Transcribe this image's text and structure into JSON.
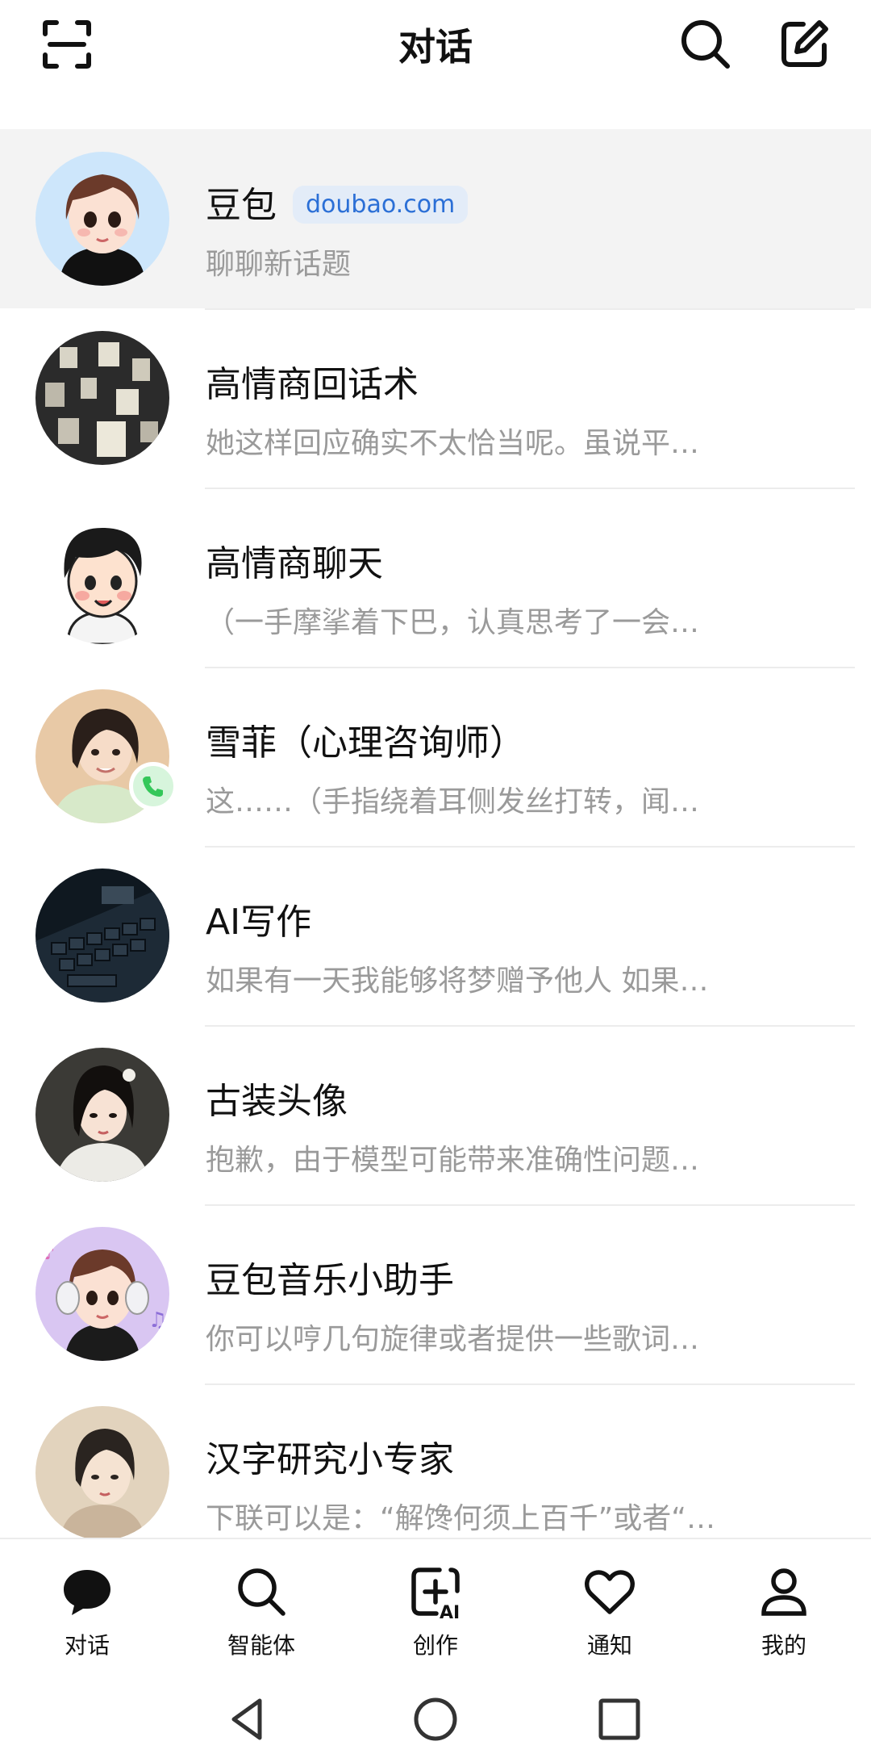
{
  "header": {
    "title": "对话"
  },
  "chats": [
    {
      "name": "豆包",
      "badge": "doubao.com",
      "preview": "聊聊新话题",
      "avatar": "doubao-girl-avatar",
      "active": true
    },
    {
      "name": "高情商回话术",
      "preview": "她这样回应确实不太恰当呢。虽说平…",
      "avatar": "lanterns-avatar"
    },
    {
      "name": "高情商聊天",
      "preview": "（一手摩挲着下巴，认真思考了一会…",
      "avatar": "cartoon-boy-avatar"
    },
    {
      "name": "雪菲（心理咨询师）",
      "preview": "这……（手指绕着耳侧发丝打转，闻…",
      "avatar": "woman-photo-avatar",
      "call_badge": "phone-icon"
    },
    {
      "name": "AI写作",
      "preview": "如果有一天我能够将梦赠予他人 如果…",
      "avatar": "keyboard-avatar"
    },
    {
      "name": "古装头像",
      "preview": "抱歉，由于模型可能带来准确性问题…",
      "avatar": "ancient-costume-avatar"
    },
    {
      "name": "豆包音乐小助手",
      "preview": "你可以哼几句旋律或者提供一些歌词…",
      "avatar": "music-girl-avatar"
    },
    {
      "name": "汉字研究小专家",
      "preview": "下联可以是：“解馋何须上百千”或者“…",
      "avatar": "painted-girl-avatar"
    }
  ],
  "bottom_nav": [
    {
      "label": "对话",
      "icon": "chat-bubble-icon",
      "selected": true
    },
    {
      "label": "智能体",
      "icon": "search-icon"
    },
    {
      "label": "创作",
      "icon": "create-ai-icon"
    },
    {
      "label": "通知",
      "icon": "heart-icon"
    },
    {
      "label": "我的",
      "icon": "profile-icon"
    }
  ],
  "system_nav": [
    "back-icon",
    "home-icon",
    "recents-icon"
  ],
  "colors": {
    "badge_bg": "#e3ecf8",
    "badge_text": "#2b6fd6",
    "active_row": "#f3f3f3",
    "preview_text": "#9a9a9a",
    "call_badge": "#34c759"
  }
}
